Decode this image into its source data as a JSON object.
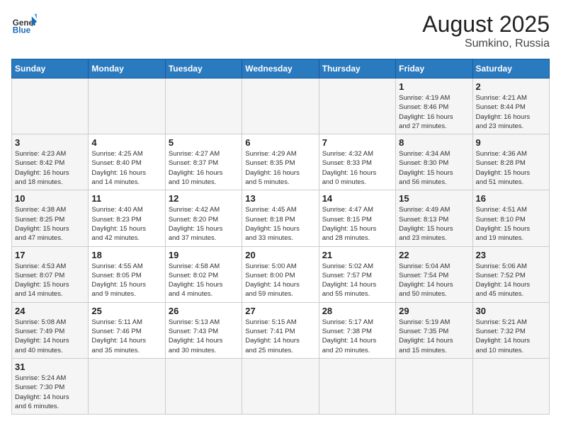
{
  "header": {
    "logo_general": "General",
    "logo_blue": "Blue",
    "month_year": "August 2025",
    "location": "Sumkino, Russia"
  },
  "weekdays": [
    "Sunday",
    "Monday",
    "Tuesday",
    "Wednesday",
    "Thursday",
    "Friday",
    "Saturday"
  ],
  "weeks": [
    [
      {
        "day": "",
        "info": "",
        "empty": true
      },
      {
        "day": "",
        "info": "",
        "empty": true
      },
      {
        "day": "",
        "info": "",
        "empty": true
      },
      {
        "day": "",
        "info": "",
        "empty": true
      },
      {
        "day": "",
        "info": "",
        "empty": true
      },
      {
        "day": "1",
        "info": "Sunrise: 4:19 AM\nSunset: 8:46 PM\nDaylight: 16 hours\nand 27 minutes.",
        "weekend": true
      },
      {
        "day": "2",
        "info": "Sunrise: 4:21 AM\nSunset: 8:44 PM\nDaylight: 16 hours\nand 23 minutes.",
        "weekend": true
      }
    ],
    [
      {
        "day": "3",
        "info": "Sunrise: 4:23 AM\nSunset: 8:42 PM\nDaylight: 16 hours\nand 18 minutes.",
        "weekend": true
      },
      {
        "day": "4",
        "info": "Sunrise: 4:25 AM\nSunset: 8:40 PM\nDaylight: 16 hours\nand 14 minutes."
      },
      {
        "day": "5",
        "info": "Sunrise: 4:27 AM\nSunset: 8:37 PM\nDaylight: 16 hours\nand 10 minutes."
      },
      {
        "day": "6",
        "info": "Sunrise: 4:29 AM\nSunset: 8:35 PM\nDaylight: 16 hours\nand 5 minutes."
      },
      {
        "day": "7",
        "info": "Sunrise: 4:32 AM\nSunset: 8:33 PM\nDaylight: 16 hours\nand 0 minutes."
      },
      {
        "day": "8",
        "info": "Sunrise: 4:34 AM\nSunset: 8:30 PM\nDaylight: 15 hours\nand 56 minutes.",
        "weekend": true
      },
      {
        "day": "9",
        "info": "Sunrise: 4:36 AM\nSunset: 8:28 PM\nDaylight: 15 hours\nand 51 minutes.",
        "weekend": true
      }
    ],
    [
      {
        "day": "10",
        "info": "Sunrise: 4:38 AM\nSunset: 8:25 PM\nDaylight: 15 hours\nand 47 minutes.",
        "weekend": true
      },
      {
        "day": "11",
        "info": "Sunrise: 4:40 AM\nSunset: 8:23 PM\nDaylight: 15 hours\nand 42 minutes."
      },
      {
        "day": "12",
        "info": "Sunrise: 4:42 AM\nSunset: 8:20 PM\nDaylight: 15 hours\nand 37 minutes."
      },
      {
        "day": "13",
        "info": "Sunrise: 4:45 AM\nSunset: 8:18 PM\nDaylight: 15 hours\nand 33 minutes."
      },
      {
        "day": "14",
        "info": "Sunrise: 4:47 AM\nSunset: 8:15 PM\nDaylight: 15 hours\nand 28 minutes."
      },
      {
        "day": "15",
        "info": "Sunrise: 4:49 AM\nSunset: 8:13 PM\nDaylight: 15 hours\nand 23 minutes.",
        "weekend": true
      },
      {
        "day": "16",
        "info": "Sunrise: 4:51 AM\nSunset: 8:10 PM\nDaylight: 15 hours\nand 19 minutes.",
        "weekend": true
      }
    ],
    [
      {
        "day": "17",
        "info": "Sunrise: 4:53 AM\nSunset: 8:07 PM\nDaylight: 15 hours\nand 14 minutes.",
        "weekend": true
      },
      {
        "day": "18",
        "info": "Sunrise: 4:55 AM\nSunset: 8:05 PM\nDaylight: 15 hours\nand 9 minutes."
      },
      {
        "day": "19",
        "info": "Sunrise: 4:58 AM\nSunset: 8:02 PM\nDaylight: 15 hours\nand 4 minutes."
      },
      {
        "day": "20",
        "info": "Sunrise: 5:00 AM\nSunset: 8:00 PM\nDaylight: 14 hours\nand 59 minutes."
      },
      {
        "day": "21",
        "info": "Sunrise: 5:02 AM\nSunset: 7:57 PM\nDaylight: 14 hours\nand 55 minutes."
      },
      {
        "day": "22",
        "info": "Sunrise: 5:04 AM\nSunset: 7:54 PM\nDaylight: 14 hours\nand 50 minutes.",
        "weekend": true
      },
      {
        "day": "23",
        "info": "Sunrise: 5:06 AM\nSunset: 7:52 PM\nDaylight: 14 hours\nand 45 minutes.",
        "weekend": true
      }
    ],
    [
      {
        "day": "24",
        "info": "Sunrise: 5:08 AM\nSunset: 7:49 PM\nDaylight: 14 hours\nand 40 minutes.",
        "weekend": true
      },
      {
        "day": "25",
        "info": "Sunrise: 5:11 AM\nSunset: 7:46 PM\nDaylight: 14 hours\nand 35 minutes."
      },
      {
        "day": "26",
        "info": "Sunrise: 5:13 AM\nSunset: 7:43 PM\nDaylight: 14 hours\nand 30 minutes."
      },
      {
        "day": "27",
        "info": "Sunrise: 5:15 AM\nSunset: 7:41 PM\nDaylight: 14 hours\nand 25 minutes."
      },
      {
        "day": "28",
        "info": "Sunrise: 5:17 AM\nSunset: 7:38 PM\nDaylight: 14 hours\nand 20 minutes."
      },
      {
        "day": "29",
        "info": "Sunrise: 5:19 AM\nSunset: 7:35 PM\nDaylight: 14 hours\nand 15 minutes.",
        "weekend": true
      },
      {
        "day": "30",
        "info": "Sunrise: 5:21 AM\nSunset: 7:32 PM\nDaylight: 14 hours\nand 10 minutes.",
        "weekend": true
      }
    ],
    [
      {
        "day": "31",
        "info": "Sunrise: 5:24 AM\nSunset: 7:30 PM\nDaylight: 14 hours\nand 6 minutes.",
        "weekend": true
      },
      {
        "day": "",
        "info": "",
        "empty": true
      },
      {
        "day": "",
        "info": "",
        "empty": true
      },
      {
        "day": "",
        "info": "",
        "empty": true
      },
      {
        "day": "",
        "info": "",
        "empty": true
      },
      {
        "day": "",
        "info": "",
        "empty": true
      },
      {
        "day": "",
        "info": "",
        "empty": true
      }
    ]
  ]
}
